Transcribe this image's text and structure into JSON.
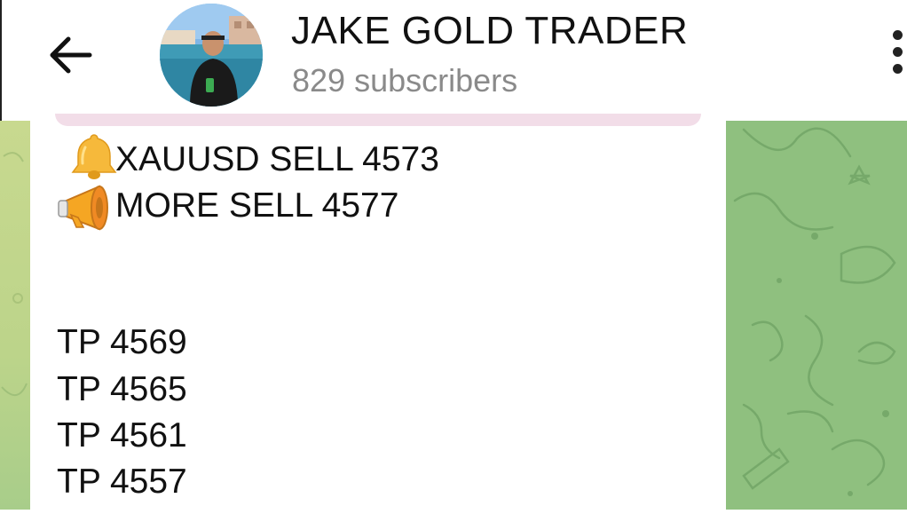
{
  "header": {
    "channel_title": "JAKE GOLD TRADER",
    "subscribers": "829 subscribers",
    "back_icon": "arrow-left-icon",
    "menu_icon": "more-vertical-icon"
  },
  "message": {
    "signal_line": "XAUUSD SELL 4573",
    "more_line": "MORE SELL 4577",
    "targets": [
      "TP 4569",
      "TP 4565",
      "TP 4561",
      "TP 4557"
    ],
    "signal_icon": "bell-icon",
    "more_icon": "megaphone-icon"
  },
  "colors": {
    "chat_background": "#8fbf7d",
    "bubble": "#ffffff",
    "subscribers_text": "#8a8a8a"
  }
}
